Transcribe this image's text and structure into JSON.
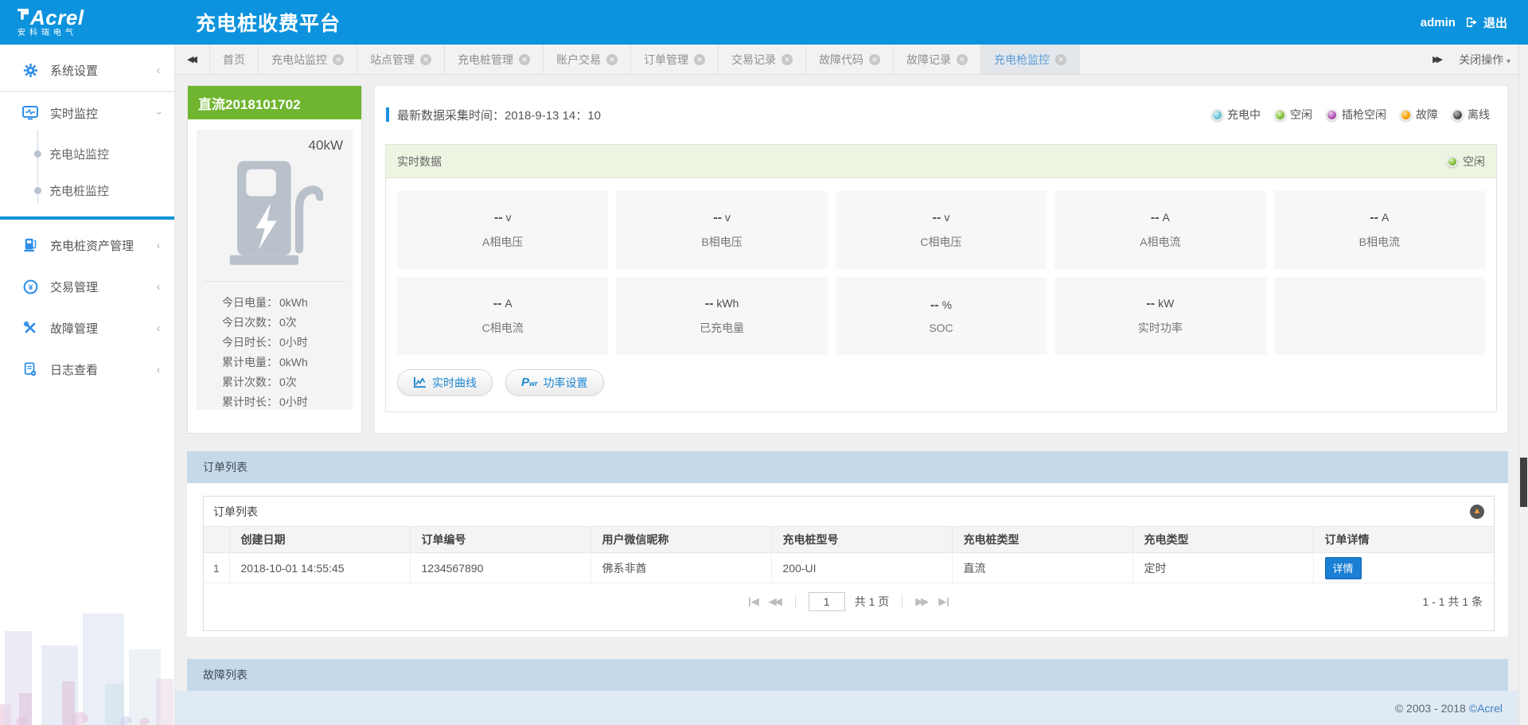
{
  "header": {
    "logo_text": "Acrel",
    "logo_subtext": "安科瑞电气",
    "title": "充电桩收费平台",
    "username": "admin",
    "logout_label": "退出"
  },
  "sidebar": {
    "items": [
      {
        "label": "系统设置",
        "icon": "gear-icon",
        "state": "collapsed"
      },
      {
        "label": "实时监控",
        "icon": "monitor-icon",
        "state": "expanded",
        "children": [
          "充电站监控",
          "充电桩监控"
        ]
      },
      {
        "label": "充电桩资产管理",
        "icon": "charging-pile-icon",
        "state": "collapsed"
      },
      {
        "label": "交易管理",
        "icon": "transaction-icon",
        "state": "collapsed"
      },
      {
        "label": "故障管理",
        "icon": "tools-icon",
        "state": "collapsed"
      },
      {
        "label": "日志查看",
        "icon": "log-icon",
        "state": "collapsed"
      }
    ]
  },
  "tabbar": {
    "tabs": [
      {
        "label": "首页",
        "closable": false,
        "active": false
      },
      {
        "label": "充电站监控",
        "closable": true,
        "active": false
      },
      {
        "label": "站点管理",
        "closable": true,
        "active": false
      },
      {
        "label": "充电桩管理",
        "closable": true,
        "active": false
      },
      {
        "label": "账户交易",
        "closable": true,
        "active": false
      },
      {
        "label": "订单管理",
        "closable": true,
        "active": false
      },
      {
        "label": "交易记录",
        "closable": true,
        "active": false
      },
      {
        "label": "故障代码",
        "closable": true,
        "active": false
      },
      {
        "label": "故障记录",
        "closable": true,
        "active": false
      },
      {
        "label": "充电枪监控",
        "closable": true,
        "active": true
      }
    ],
    "close_menu_label": "关闭操作"
  },
  "device_card": {
    "title": "直流2018101702",
    "power": "40kW",
    "stats": [
      {
        "label": "今日电量：",
        "value": "0kWh"
      },
      {
        "label": "今日次数：",
        "value": "0次"
      },
      {
        "label": "今日时长：",
        "value": "0小时"
      },
      {
        "label": "累计电量：",
        "value": "0kWh"
      },
      {
        "label": "累计次数：",
        "value": "0次"
      },
      {
        "label": "累计时长：",
        "value": "0小时"
      }
    ]
  },
  "monitor": {
    "collect_label": "最新数据采集时间：",
    "collect_value": "2018-9-13 14：10",
    "legend": [
      {
        "label": "充电中",
        "color": "#6fc8d7"
      },
      {
        "label": "空闲",
        "color": "#85c240"
      },
      {
        "label": "插枪空闲",
        "color": "#b35ab3"
      },
      {
        "label": "故障",
        "color": "#f7a400"
      },
      {
        "label": "离线",
        "color": "#444444"
      }
    ],
    "realtime": {
      "title": "实时数据",
      "status": "空闲",
      "status_color": "#85c240",
      "metrics": [
        {
          "value": "--",
          "unit": "v",
          "label": "A相电压"
        },
        {
          "value": "--",
          "unit": "v",
          "label": "B相电压"
        },
        {
          "value": "--",
          "unit": "v",
          "label": "C相电压"
        },
        {
          "value": "--",
          "unit": "A",
          "label": "A相电流"
        },
        {
          "value": "--",
          "unit": "A",
          "label": "B相电流"
        },
        {
          "value": "--",
          "unit": "A",
          "label": "C相电流"
        },
        {
          "value": "--",
          "unit": "kWh",
          "label": "已充电量"
        },
        {
          "value": "--",
          "unit": "%",
          "label": "SOC"
        },
        {
          "value": "--",
          "unit": "kW",
          "label": "实时功率"
        }
      ],
      "buttons": [
        {
          "label": "实时曲线",
          "icon": "curve-chart-icon"
        },
        {
          "label": "功率设置",
          "icon": "power-setting-icon"
        }
      ]
    }
  },
  "order_section": {
    "header": "订单列表",
    "panel_title": "订单列表",
    "table": {
      "columns": [
        "创建日期",
        "订单编号",
        "用户微信昵称",
        "充电桩型号",
        "充电桩类型",
        "充电类型",
        "订单详情"
      ],
      "rows": [
        {
          "index": "1",
          "cells": [
            "2018-10-01 14:55:45",
            "1234567890",
            "佛系非酋",
            "200-UI",
            "直流",
            "定时"
          ],
          "action": "详情"
        }
      ]
    },
    "pagination": {
      "page": "1",
      "total_pages_label": "共 1 页",
      "range_label": "1 - 1  共 1 条"
    }
  },
  "fault_section": {
    "header": "故障列表"
  },
  "footer": {
    "copyright_prefix": "© 2003 - 2018",
    "copyright_brand": "©Acrel"
  },
  "colors": {
    "header_blue": "#0d93dd",
    "card_green": "#6fb52f",
    "section_bar_blue": "#c6d9ea",
    "detail_button_blue": "#1b7fd4"
  }
}
